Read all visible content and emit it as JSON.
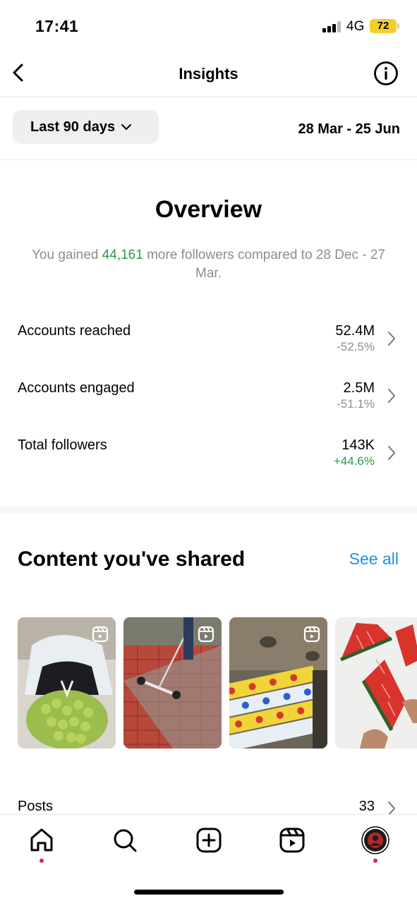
{
  "status_bar": {
    "time": "17:41",
    "network": "4G",
    "battery": "72"
  },
  "header": {
    "title": "Insights",
    "back_icon": "chevron-left-icon",
    "info_icon": "info-icon"
  },
  "range": {
    "selected": "Last 90 days",
    "dates": "28 Mar - 25 Jun"
  },
  "overview": {
    "title": "Overview",
    "subtitle_prefix": "You gained ",
    "followers_gained": "44,161",
    "subtitle_suffix": " more followers compared to 28 Dec - 27 Mar.",
    "metrics": [
      {
        "label": "Accounts reached",
        "value": "52.4M",
        "change": "-52.5%",
        "trend": "negative"
      },
      {
        "label": "Accounts engaged",
        "value": "2.5M",
        "change": "-51.1%",
        "trend": "negative"
      },
      {
        "label": "Total followers",
        "value": "143K",
        "change": "+44.6%",
        "trend": "positive"
      }
    ]
  },
  "content": {
    "title": "Content you've shared",
    "see_all": "See all",
    "thumbnails": [
      {
        "subject": "person with bag of limes",
        "icon": "reel-icon"
      },
      {
        "subject": "pressure washing brick pavement",
        "icon": "reel-icon"
      },
      {
        "subject": "sticker strips in machine",
        "icon": "reel-icon"
      },
      {
        "subject": "watermelon slices",
        "icon": "reel-icon"
      }
    ],
    "posts": {
      "label": "Posts",
      "count": "33"
    }
  },
  "bottom_nav": {
    "items": [
      "home-icon",
      "search-icon",
      "create-icon",
      "reels-icon",
      "profile-avatar"
    ]
  },
  "colors": {
    "positive": "#2c9b46",
    "muted": "#8e8e8e",
    "link": "#1e90e8",
    "notification_dot": "#e0245e",
    "battery": "#f4cf2a"
  }
}
